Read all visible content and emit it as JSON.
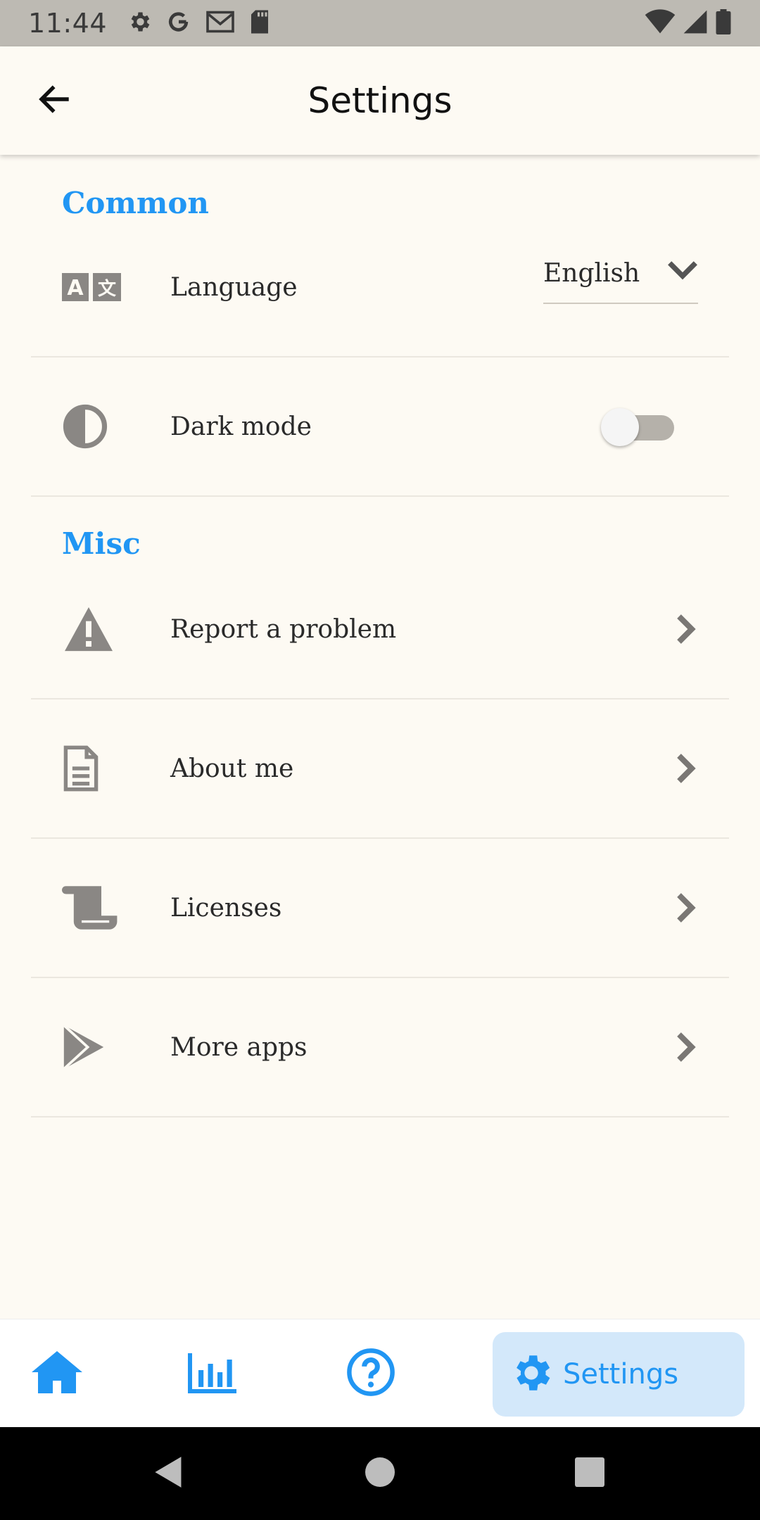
{
  "status_bar": {
    "time": "11:44",
    "icons": [
      "gear-icon",
      "google-icon",
      "gmail-icon",
      "sd-card-icon"
    ],
    "right_icons": [
      "wifi-icon",
      "signal-icon",
      "battery-icon"
    ]
  },
  "app_bar": {
    "title": "Settings",
    "back_icon": "arrow-left-icon"
  },
  "sections": {
    "common": {
      "header": "Common",
      "language": {
        "label": "Language",
        "icon": "translate-icon",
        "selected_value": "English"
      },
      "dark_mode": {
        "label": "Dark mode",
        "icon": "contrast-icon",
        "enabled": false
      }
    },
    "misc": {
      "header": "Misc",
      "items": [
        {
          "label": "Report a problem",
          "icon": "warning-icon"
        },
        {
          "label": "About me",
          "icon": "document-icon"
        },
        {
          "label": "Licenses",
          "icon": "scroll-icon"
        },
        {
          "label": "More apps",
          "icon": "play-store-icon"
        }
      ]
    }
  },
  "bottom_nav": {
    "items": [
      {
        "icon": "home-icon"
      },
      {
        "icon": "chart-icon"
      },
      {
        "icon": "help-icon"
      },
      {
        "icon": "gear-icon",
        "label": "Settings",
        "active": true
      }
    ]
  },
  "colors": {
    "accent": "#2196f3",
    "background": "#fdfaf3",
    "icon_gray": "#8a8784",
    "active_nav_bg": "#d3e8fa"
  }
}
